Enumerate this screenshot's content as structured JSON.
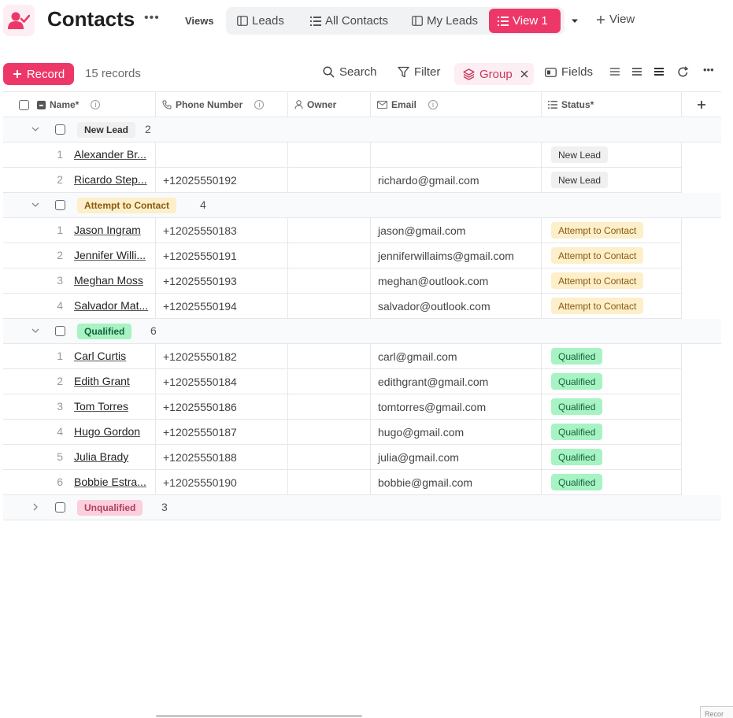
{
  "header": {
    "title": "Contacts",
    "views_label": "Views",
    "tabs": [
      {
        "label": "Leads"
      },
      {
        "label": "All Contacts"
      },
      {
        "label": "My Leads"
      },
      {
        "label": "View 1"
      }
    ],
    "add_view_label": "View"
  },
  "toolbar": {
    "record_label": "Record",
    "record_count": "15 records",
    "search_label": "Search",
    "filter_label": "Filter",
    "group_label": "Group",
    "fields_label": "Fields"
  },
  "columns": [
    {
      "label": "Name*"
    },
    {
      "label": "Phone Number"
    },
    {
      "label": "Owner"
    },
    {
      "label": "Email"
    },
    {
      "label": "Status*"
    }
  ],
  "groups": [
    {
      "label": "New Lead",
      "count": "2",
      "rows": [
        {
          "num": "1",
          "name": "Alexander Br...",
          "phone": "",
          "email": "",
          "status": "New Lead"
        },
        {
          "num": "2",
          "name": "Ricardo Step...",
          "phone": "+12025550192",
          "email": "richardo@gmail.com",
          "status": "New Lead"
        }
      ]
    },
    {
      "label": "Attempt to Contact",
      "count": "4",
      "rows": [
        {
          "num": "1",
          "name": "Jason Ingram",
          "phone": "+12025550183",
          "email": "jason@gmail.com",
          "status": "Attempt to Contact"
        },
        {
          "num": "2",
          "name": "Jennifer Willi...",
          "phone": "+12025550191",
          "email": "jenniferwillaims@gmail.com",
          "status": "Attempt to Contact"
        },
        {
          "num": "3",
          "name": "Meghan Moss",
          "phone": "+12025550193",
          "email": "meghan@outlook.com",
          "status": "Attempt to Contact"
        },
        {
          "num": "4",
          "name": "Salvador Mat...",
          "phone": "+12025550194",
          "email": "salvador@outlook.com",
          "status": "Attempt to Contact"
        }
      ]
    },
    {
      "label": "Qualified",
      "count": "6",
      "rows": [
        {
          "num": "1",
          "name": "Carl Curtis",
          "phone": "+12025550182",
          "email": "carl@gmail.com",
          "status": "Qualified"
        },
        {
          "num": "2",
          "name": "Edith Grant",
          "phone": "+12025550184",
          "email": "edithgrant@gmail.com",
          "status": "Qualified"
        },
        {
          "num": "3",
          "name": "Tom Torres",
          "phone": "+12025550186",
          "email": "tomtorres@gmail.com",
          "status": "Qualified"
        },
        {
          "num": "4",
          "name": "Hugo Gordon",
          "phone": "+12025550187",
          "email": "hugo@gmail.com",
          "status": "Qualified"
        },
        {
          "num": "5",
          "name": "Julia Brady",
          "phone": "+12025550188",
          "email": "julia@gmail.com",
          "status": "Qualified"
        },
        {
          "num": "6",
          "name": "Bobbie Estra...",
          "phone": "+12025550190",
          "email": "bobbie@gmail.com",
          "status": "Qualified"
        }
      ]
    },
    {
      "label": "Unqualified",
      "count": "3",
      "rows": []
    }
  ],
  "colors": {
    "accent": "#ee3769",
    "new_lead_bg": "#f0f0f0",
    "new_lead_fg": "#333333",
    "attempt_bg": "#fcefc9",
    "attempt_fg": "#8a5a12",
    "qualified_bg": "#a7f3c4",
    "qualified_fg": "#14633a",
    "unqualified_bg": "#fbcfdc",
    "unqualified_fg": "#b0405f"
  },
  "corner_text": "Recor"
}
